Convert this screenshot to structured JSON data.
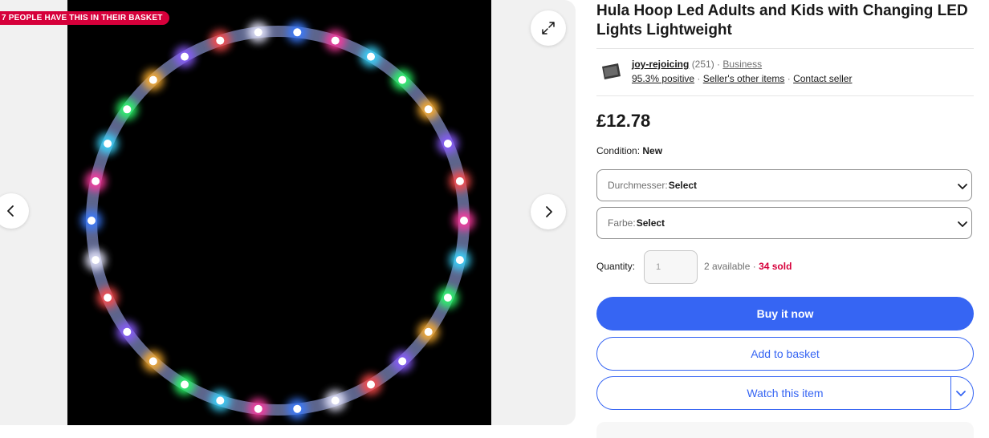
{
  "gallery": {
    "badge": "7 PEOPLE HAVE THIS IN THEIR BASKET",
    "icons": {
      "prev": "chevron-left-icon",
      "next": "chevron-right-icon",
      "expand": "expand-icon"
    },
    "led_colors": [
      "#ff3aa0",
      "#3ad7ff",
      "#2bff6a",
      "#ffb02e",
      "#8a5bff",
      "#ff4b4b",
      "#e8e8ff",
      "#3a7bff"
    ]
  },
  "listing": {
    "title": "Hula Hoop Led Adults and Kids with Changing LED Lights Lightweight",
    "seller": {
      "name": "joy-rejoicing",
      "feedback_count": "(251)",
      "type": "Business",
      "positive": "95.3% positive",
      "other_items": "Seller's other items",
      "contact": "Contact seller"
    },
    "price": "£12.78",
    "condition_label": "Condition:",
    "condition_value": "New",
    "options": [
      {
        "label": "Durchmesser:",
        "value": "Select"
      },
      {
        "label": "Farbe:",
        "value": "Select"
      }
    ],
    "quantity": {
      "label": "Quantity:",
      "value": "1",
      "available": "2 available",
      "sold": "34 sold"
    },
    "buttons": {
      "buy_now": "Buy it now",
      "add_to_basket": "Add to basket",
      "watch": "Watch this item"
    }
  },
  "colors": {
    "accent": "#3665f3",
    "badge": "#d6003b",
    "sold": "#d6003b"
  }
}
